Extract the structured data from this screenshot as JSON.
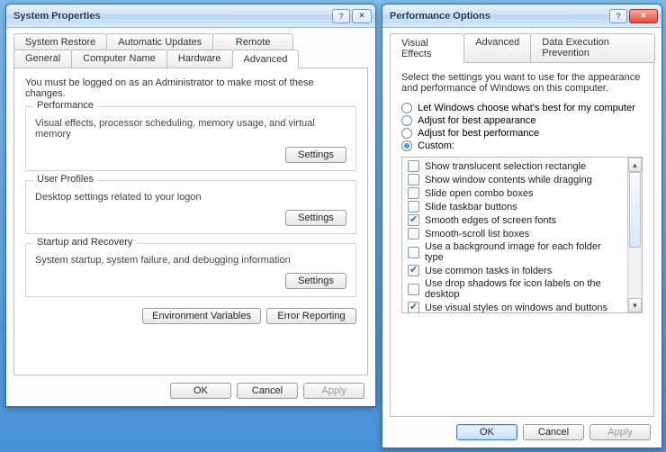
{
  "system_properties": {
    "title": "System Properties",
    "tabs_row1": [
      "System Restore",
      "Automatic Updates",
      "Remote"
    ],
    "tabs_row2": [
      "General",
      "Computer Name",
      "Hardware",
      "Advanced"
    ],
    "active_tab": "Advanced",
    "admin_hint": "You must be logged on as an Administrator to make most of these changes.",
    "groups": {
      "performance": {
        "title": "Performance",
        "desc": "Visual effects, processor scheduling, memory usage, and virtual memory",
        "settings_btn": "Settings"
      },
      "user_profiles": {
        "title": "User Profiles",
        "desc": "Desktop settings related to your logon",
        "settings_btn": "Settings"
      },
      "startup": {
        "title": "Startup and Recovery",
        "desc": "System startup, system failure, and debugging information",
        "settings_btn": "Settings"
      }
    },
    "env_vars_btn": "Environment Variables",
    "error_report_btn": "Error Reporting",
    "ok_btn": "OK",
    "cancel_btn": "Cancel",
    "apply_btn": "Apply"
  },
  "performance_options": {
    "title": "Performance Options",
    "tabs": [
      "Visual Effects",
      "Advanced",
      "Data Execution Prevention"
    ],
    "active_tab": "Visual Effects",
    "intro": "Select the settings you want to use for the appearance and performance of Windows on this computer.",
    "radios": [
      {
        "label": "Let Windows choose what's best for my computer",
        "checked": false
      },
      {
        "label": "Adjust for best appearance",
        "checked": false
      },
      {
        "label": "Adjust for best performance",
        "checked": false
      },
      {
        "label": "Custom:",
        "checked": true
      }
    ],
    "checks": [
      {
        "label": "Show translucent selection rectangle",
        "checked": false
      },
      {
        "label": "Show window contents while dragging",
        "checked": false
      },
      {
        "label": "Slide open combo boxes",
        "checked": false
      },
      {
        "label": "Slide taskbar buttons",
        "checked": false
      },
      {
        "label": "Smooth edges of screen fonts",
        "checked": true
      },
      {
        "label": "Smooth-scroll list boxes",
        "checked": false
      },
      {
        "label": "Use a background image for each folder type",
        "checked": false
      },
      {
        "label": "Use common tasks in folders",
        "checked": true
      },
      {
        "label": "Use drop shadows for icon labels on the desktop",
        "checked": false
      },
      {
        "label": "Use visual styles on windows and buttons",
        "checked": true
      }
    ],
    "ok_btn": "OK",
    "cancel_btn": "Cancel",
    "apply_btn": "Apply"
  }
}
